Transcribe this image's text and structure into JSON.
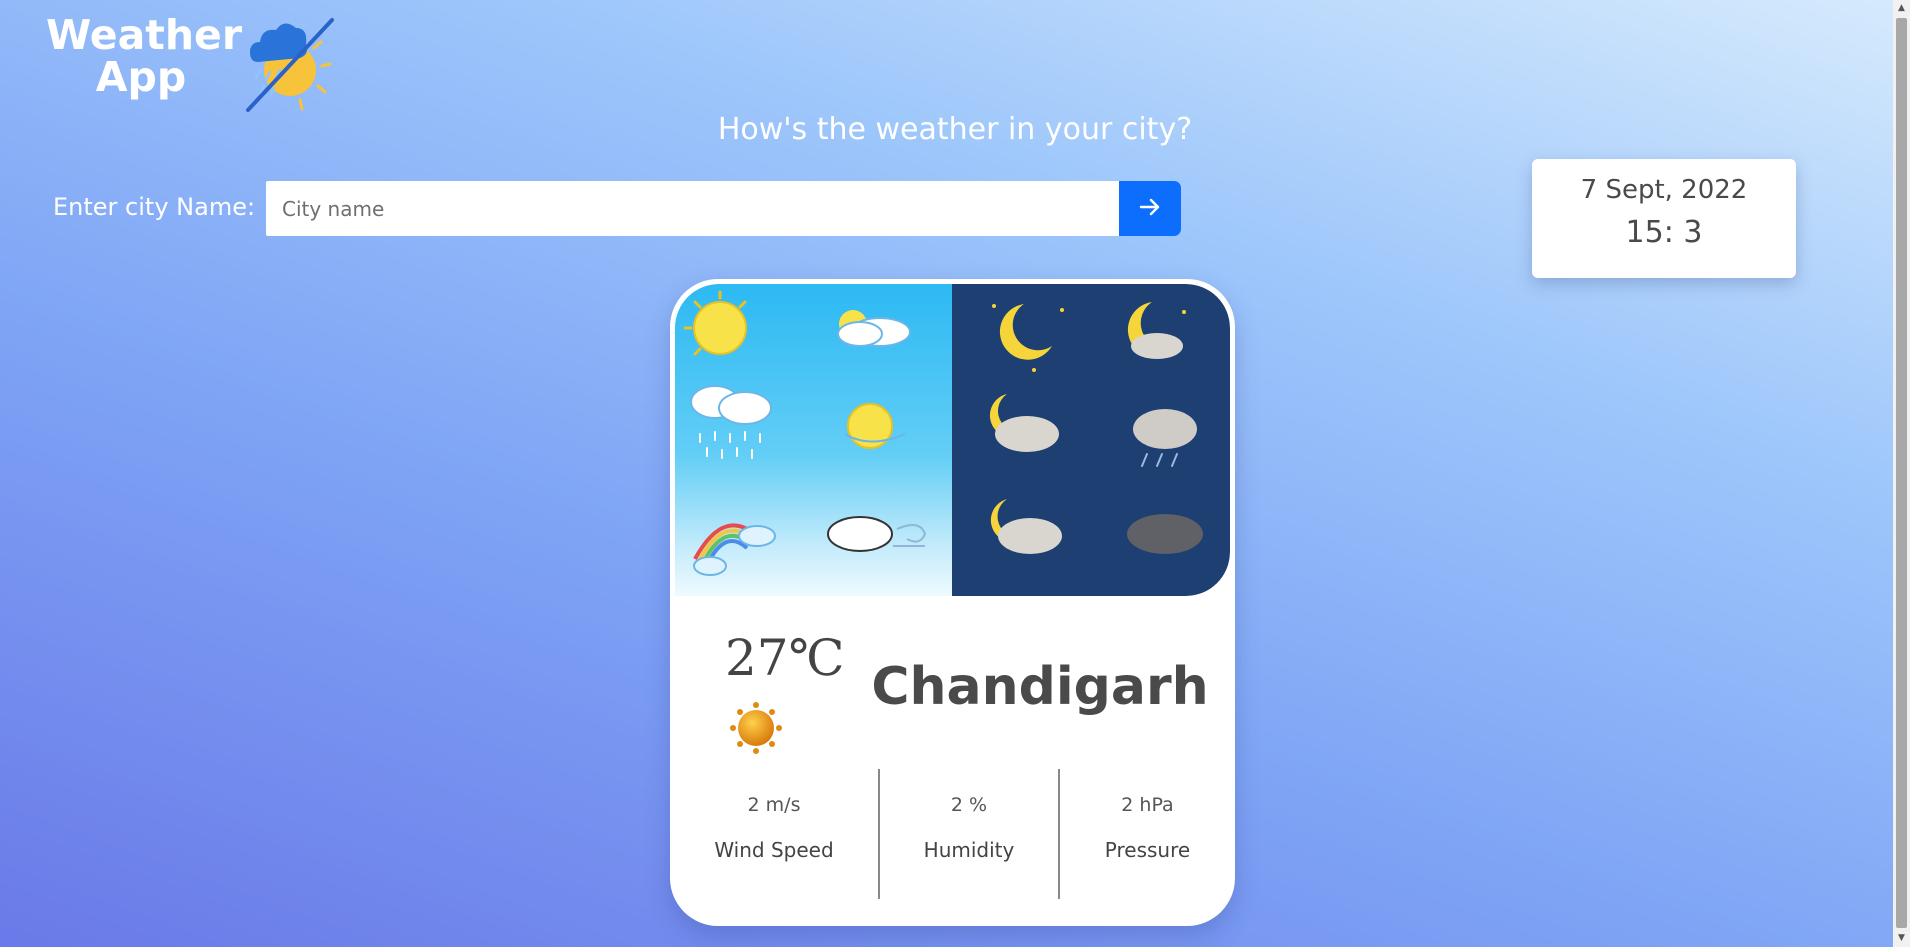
{
  "app": {
    "title": "Weather App"
  },
  "header": {
    "headline": "How's the weather in your city?"
  },
  "search": {
    "label": "Enter city Name:",
    "placeholder": "City name",
    "value": "",
    "button_icon": "arrow-right-icon"
  },
  "datetime": {
    "date": "7 Sept, 2022",
    "time": "15: 3"
  },
  "weather": {
    "temperature": "27℃",
    "condition_icon": "sun-icon",
    "city": "Chandigarh",
    "stats": [
      {
        "value": "2 m/s",
        "label": "Wind Speed"
      },
      {
        "value": "2 %",
        "label": "Humidity"
      },
      {
        "value": "2 hPa",
        "label": "Pressure"
      }
    ]
  },
  "colors": {
    "accent": "#0d6efd",
    "card": "#ffffff",
    "night_panel": "#1d3f72",
    "day_panel": "#2db9f3"
  }
}
